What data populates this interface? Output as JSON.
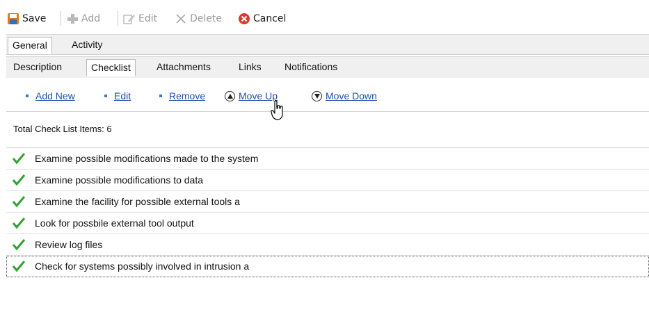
{
  "toolbar": {
    "save": "Save",
    "add": "Add",
    "edit": "Edit",
    "delete": "Delete",
    "cancel": "Cancel"
  },
  "main_tabs": [
    {
      "label": "General",
      "active": true
    },
    {
      "label": "Activity",
      "active": false
    }
  ],
  "sub_tabs": [
    {
      "label": "Description",
      "active": false
    },
    {
      "label": "Checklist",
      "active": true
    },
    {
      "label": "Attachments",
      "active": false
    },
    {
      "label": "Links",
      "active": false
    },
    {
      "label": "Notifications",
      "active": false
    }
  ],
  "actions": {
    "add_new": "Add New",
    "edit": "Edit",
    "remove": "Remove",
    "move_up": "Move Up",
    "move_down": "Move Down"
  },
  "total_label": "Total Check List Items: 6",
  "checklist": [
    {
      "text": "Examine possible modifications made to the system",
      "checked": true
    },
    {
      "text": "Examine possible modifications to data",
      "checked": true
    },
    {
      "text": "Examine the facility for possible external tools a",
      "checked": true
    },
    {
      "text": "Look for possbile external tool output",
      "checked": true
    },
    {
      "text": "Review log files",
      "checked": true
    },
    {
      "text": "Check for systems possibly involved in intrusion a",
      "checked": true,
      "selected": true
    }
  ],
  "colors": {
    "link": "#1f4ea8",
    "check": "#2aa52a",
    "cancel_icon": "#d63a2a"
  }
}
